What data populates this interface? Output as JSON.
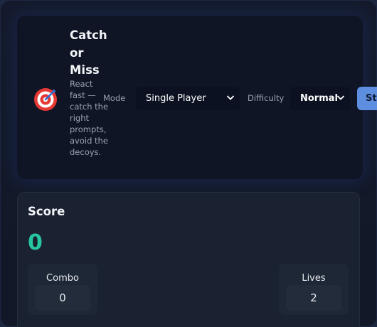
{
  "header": {
    "title": "Catch or Miss",
    "subtitle": "React fast — catch the right prompts, avoid the decoys.",
    "logo_icon": "target-dart-icon"
  },
  "controls": {
    "mode_label": "Mode",
    "mode_value": "Single Player",
    "difficulty_label": "Difficulty",
    "difficulty_value": "Normal",
    "start_label": "Start"
  },
  "score": {
    "label": "Score",
    "value": "0"
  },
  "stats": {
    "combo_label": "Combo",
    "combo_value": "0",
    "lives_label": "Lives",
    "lives_value": "2"
  },
  "colors": {
    "accent": "#26c6a0",
    "button": "#5d8ee0",
    "target_red": "#e53935"
  }
}
